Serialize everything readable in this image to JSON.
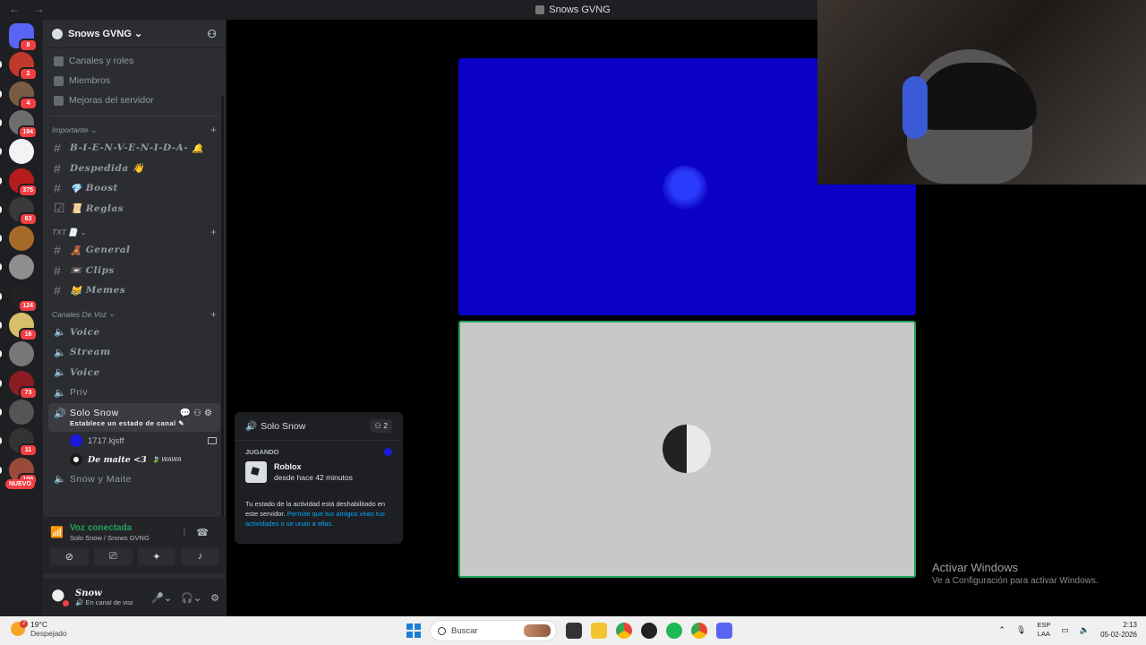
{
  "window": {
    "title": "Snows GVNG",
    "nav": "← →"
  },
  "servers": [
    {
      "badge": "8",
      "color": "#5865f2"
    },
    {
      "badge": "2",
      "color": "#c0392b"
    },
    {
      "badge": "4",
      "color": "#7a5c44"
    },
    {
      "badge": "194",
      "color": "#6d6d6d"
    },
    {
      "badge": "",
      "color": "#f2f3f5"
    },
    {
      "badge": "375",
      "color": "#b71c1c"
    },
    {
      "badge": "63",
      "color": "#3a3a3a"
    },
    {
      "badge": "",
      "color": "#a56a2a"
    },
    {
      "badge": "",
      "color": "#8e8e8e"
    },
    {
      "badge": "124",
      "color": "#222222"
    },
    {
      "badge": "16",
      "color": "#d8c06a"
    },
    {
      "badge": "",
      "color": "#777777"
    },
    {
      "badge": "73",
      "color": "#8b1c24"
    },
    {
      "badge": "",
      "color": "#555555"
    },
    {
      "badge": "11",
      "color": "#333333"
    },
    {
      "badge": "100",
      "color": "#9a4a3a"
    }
  ],
  "nuevo": "NUEVO",
  "server": {
    "name": "Snows GVNG",
    "nav": [
      "Canales y roles",
      "Miembros",
      "Mejoras del servidor"
    ]
  },
  "categories": {
    "importante": "Importante",
    "txt": "TXT",
    "voz": "Canales De Voz"
  },
  "text_channels_a": [
    "B-I-E-N-V-E-N-I-D-A-",
    "Despedida",
    "Boost",
    "Reglas"
  ],
  "text_channels_b": [
    "General",
    "Clips",
    "Memes"
  ],
  "voice_channels": [
    "Voice",
    "Stream",
    "Voice",
    "Priv"
  ],
  "active_channel": {
    "name": "Solo Snow",
    "status": "Establece un estado de canal"
  },
  "voice_users": [
    {
      "name": "1717.kjsff",
      "tag": ""
    },
    {
      "name": "De maite <3",
      "tag": "WAWA"
    }
  ],
  "last_channel": "Snow y Maite",
  "voice_panel": {
    "title": "Voz conectada",
    "sub": "Solo Snow / Snows GVNG"
  },
  "user": {
    "name": "Snow",
    "status": "En canal de voz"
  },
  "popup": {
    "channel": "Solo Snow",
    "count": "2",
    "label": "JUGANDO",
    "game": "Roblox",
    "time": "desde hace 42 minutos",
    "note": "Tu estado de la actividad está deshabilitado en este servidor.",
    "link": "Permite que tus amigos vean tus actividades o se unan a ellas."
  },
  "activate": {
    "line1": "Activar Windows",
    "line2": "Ve a Configuración para activar Windows."
  },
  "taskbar": {
    "weather_temp": "19°C",
    "weather_desc": "Despejado",
    "weather_badge": "2",
    "search": "Buscar",
    "lang1": "ESP",
    "lang2": "LAA",
    "time": "2:13",
    "date": "05-02-2026"
  }
}
